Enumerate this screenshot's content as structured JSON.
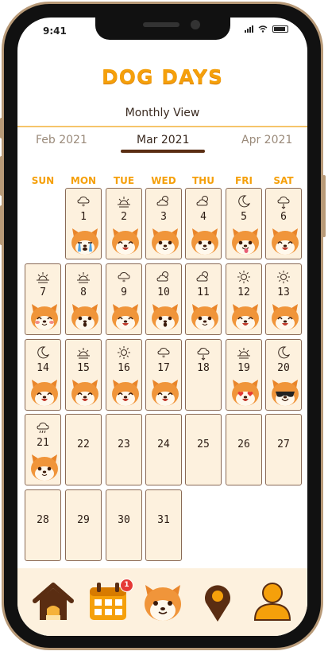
{
  "app": {
    "title": "DOG DAYS"
  },
  "status": {
    "time": "9:41"
  },
  "view": {
    "label": "Monthly View"
  },
  "months": {
    "prev": "Feb 2021",
    "current": "Mar 2021",
    "next": "Apr 2021"
  },
  "weekdays": [
    "SUN",
    "MON",
    "TUE",
    "WED",
    "THU",
    "FRI",
    "SAT"
  ],
  "colors": {
    "accent": "#f5a00b",
    "cell_bg": "#fdf1de",
    "cell_border": "#8a6a56",
    "brown": "#5a2d12"
  },
  "days": [
    {
      "day": "1",
      "weather": "snow-cloud-icon",
      "mood": "crying"
    },
    {
      "day": "2",
      "weather": "sunrise-icon",
      "mood": "happy"
    },
    {
      "day": "3",
      "weather": "partly-cloudy-icon",
      "mood": "calm"
    },
    {
      "day": "4",
      "weather": "partly-cloudy-icon",
      "mood": "calm"
    },
    {
      "day": "5",
      "weather": "moon-icon",
      "mood": "tongue"
    },
    {
      "day": "6",
      "weather": "rain-cloud-icon",
      "mood": "happy"
    },
    {
      "day": "7",
      "weather": "sunrise-icon",
      "mood": "blush"
    },
    {
      "day": "8",
      "weather": "sunrise-icon",
      "mood": "surprised"
    },
    {
      "day": "9",
      "weather": "snow-cloud-icon",
      "mood": "happy"
    },
    {
      "day": "10",
      "weather": "partly-cloudy-icon",
      "mood": "surprised"
    },
    {
      "day": "11",
      "weather": "partly-cloudy-icon",
      "mood": "calm"
    },
    {
      "day": "12",
      "weather": "sun-icon",
      "mood": "happy"
    },
    {
      "day": "13",
      "weather": "sun-icon",
      "mood": "happy"
    },
    {
      "day": "14",
      "weather": "moon-icon",
      "mood": "happy"
    },
    {
      "day": "15",
      "weather": "sunrise-icon",
      "mood": "happy"
    },
    {
      "day": "16",
      "weather": "sun-icon",
      "mood": "happy"
    },
    {
      "day": "17",
      "weather": "snow-cloud-icon",
      "mood": "happy"
    },
    {
      "day": "18",
      "weather": "rain-cloud-icon",
      "mood": ""
    },
    {
      "day": "19",
      "weather": "sunrise-icon",
      "mood": "love"
    },
    {
      "day": "20",
      "weather": "moon-icon",
      "mood": "cool"
    },
    {
      "day": "21",
      "weather": "rain-icon",
      "mood": "calm"
    },
    {
      "day": "22",
      "weather": "",
      "mood": ""
    },
    {
      "day": "23",
      "weather": "",
      "mood": ""
    },
    {
      "day": "24",
      "weather": "",
      "mood": ""
    },
    {
      "day": "25",
      "weather": "",
      "mood": ""
    },
    {
      "day": "26",
      "weather": "",
      "mood": ""
    },
    {
      "day": "27",
      "weather": "",
      "mood": ""
    },
    {
      "day": "28",
      "weather": "",
      "mood": ""
    },
    {
      "day": "29",
      "weather": "",
      "mood": ""
    },
    {
      "day": "30",
      "weather": "",
      "mood": ""
    },
    {
      "day": "31",
      "weather": "",
      "mood": ""
    }
  ],
  "tabs": [
    {
      "name": "home-icon"
    },
    {
      "name": "calendar-icon",
      "badge": "1"
    },
    {
      "name": "dog-face-icon"
    },
    {
      "name": "location-pin-icon"
    },
    {
      "name": "profile-icon"
    }
  ]
}
